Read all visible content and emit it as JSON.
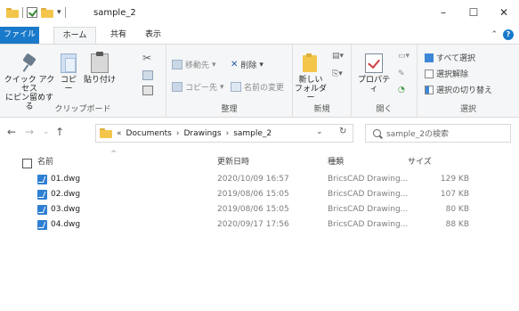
{
  "window": {
    "title": "sample_2",
    "controls": {
      "minimize": "–",
      "maximize": "☐",
      "close": "✕"
    }
  },
  "tabs": [
    {
      "label": "ファイル"
    },
    {
      "label": "ホーム"
    },
    {
      "label": "共有"
    },
    {
      "label": "表示"
    }
  ],
  "ribbon": {
    "clipboard": {
      "pin_label_line1": "クイック アクセス",
      "pin_label_line2": "にピン留めする",
      "copy_label": "コピー",
      "paste_label": "貼り付け",
      "group_label": "クリップボード"
    },
    "organize": {
      "move_label": "移動先",
      "delete_label": "削除",
      "copyto_label": "コピー先",
      "rename_label": "名前の変更",
      "group_label": "整理"
    },
    "new": {
      "new_folder_line1": "新しい",
      "new_folder_line2": "フォルダー",
      "group_label": "新規"
    },
    "open": {
      "properties_label": "プロパティ",
      "group_label": "開く"
    },
    "select": {
      "select_all": "すべて選択",
      "select_none": "選択解除",
      "invert": "選択の切り替え",
      "group_label": "選択"
    }
  },
  "nav": {
    "back": "←",
    "forward": "→",
    "recent": "⌄",
    "up": "↑"
  },
  "address": {
    "prefix": "«",
    "crumbs": [
      "Documents",
      "Drawings",
      "sample_2"
    ],
    "separator": "›",
    "dropdown": "⌄",
    "refresh": "↻"
  },
  "search": {
    "placeholder": "sample_2の検索"
  },
  "columns": {
    "name": "名前",
    "date": "更新日時",
    "type": "種類",
    "size": "サイズ"
  },
  "files": [
    {
      "name": "01.dwg",
      "date": "2020/10/09 16:57",
      "type": "BricsCAD Drawing...",
      "size": "129 KB"
    },
    {
      "name": "02.dwg",
      "date": "2019/08/06 15:05",
      "type": "BricsCAD Drawing...",
      "size": "107 KB"
    },
    {
      "name": "03.dwg",
      "date": "2019/08/06 15:05",
      "type": "BricsCAD Drawing...",
      "size": "80 KB"
    },
    {
      "name": "04.dwg",
      "date": "2020/09/17 17:56",
      "type": "BricsCAD Drawing...",
      "size": "88 KB"
    }
  ]
}
